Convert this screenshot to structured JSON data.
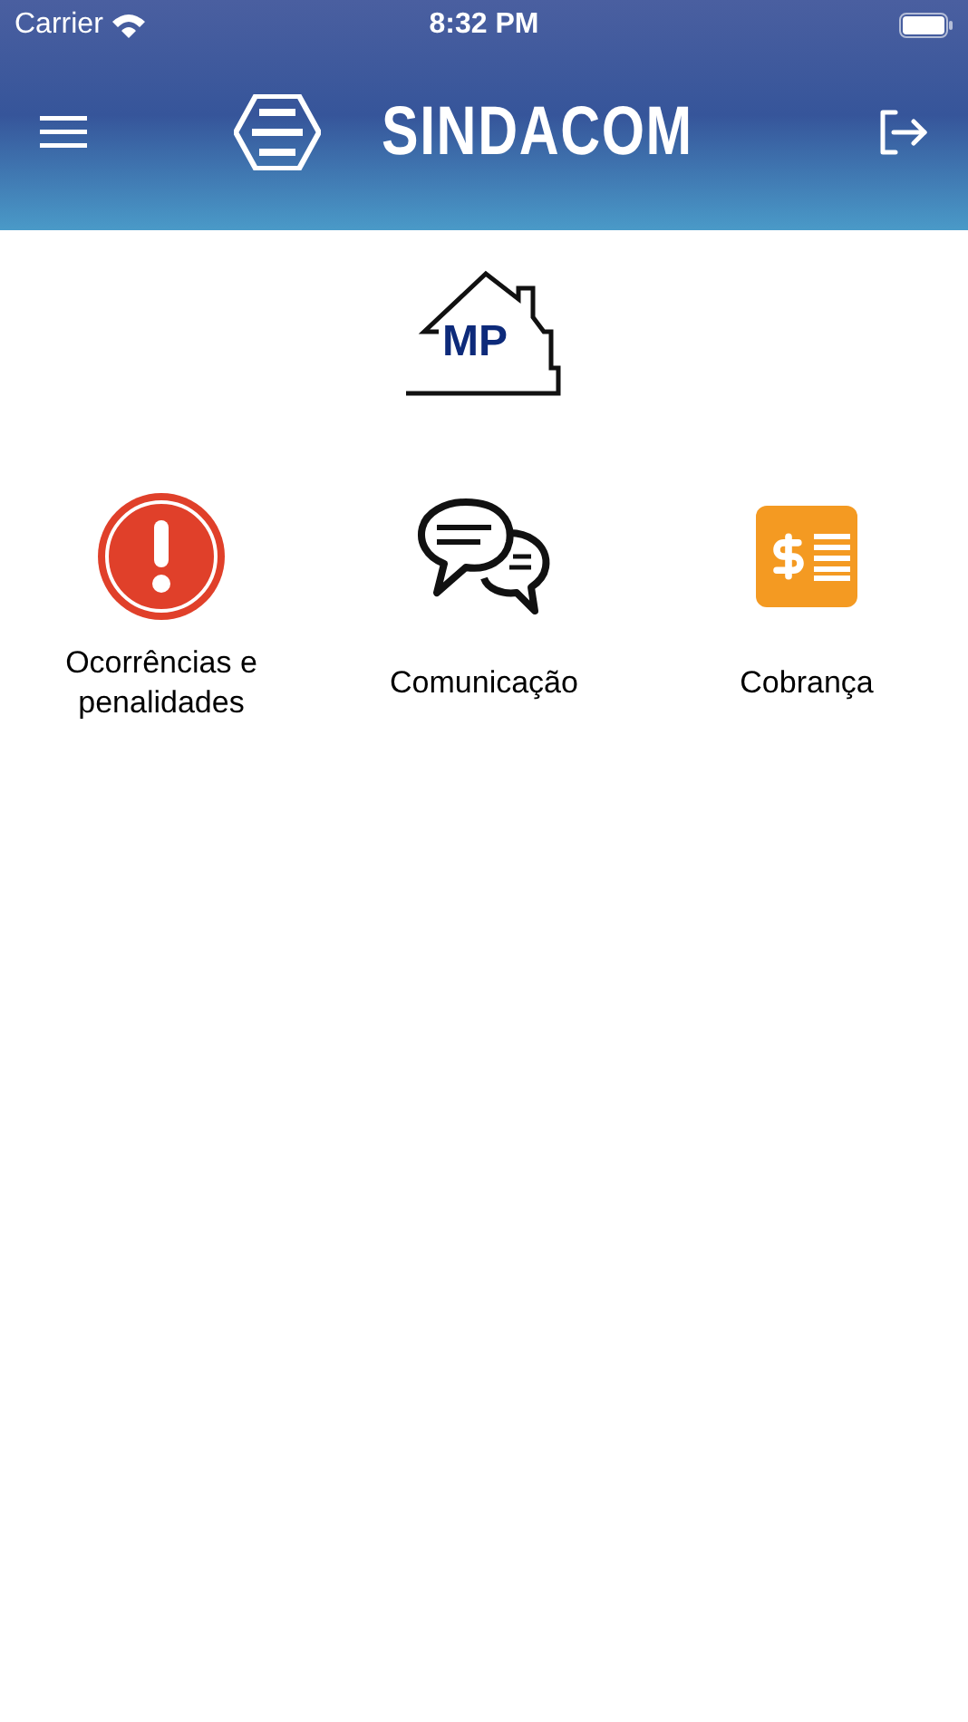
{
  "status_bar": {
    "carrier": "Carrier",
    "time": "8:32 PM"
  },
  "header": {
    "brand": "SINDACOM"
  },
  "condo_logo": {
    "initials": "MP"
  },
  "menu_items": [
    {
      "kind": "alert",
      "label": "Ocorrências e penalidades"
    },
    {
      "kind": "chat",
      "label": "Comunicação"
    },
    {
      "kind": "billing",
      "label": "Cobrança"
    }
  ]
}
